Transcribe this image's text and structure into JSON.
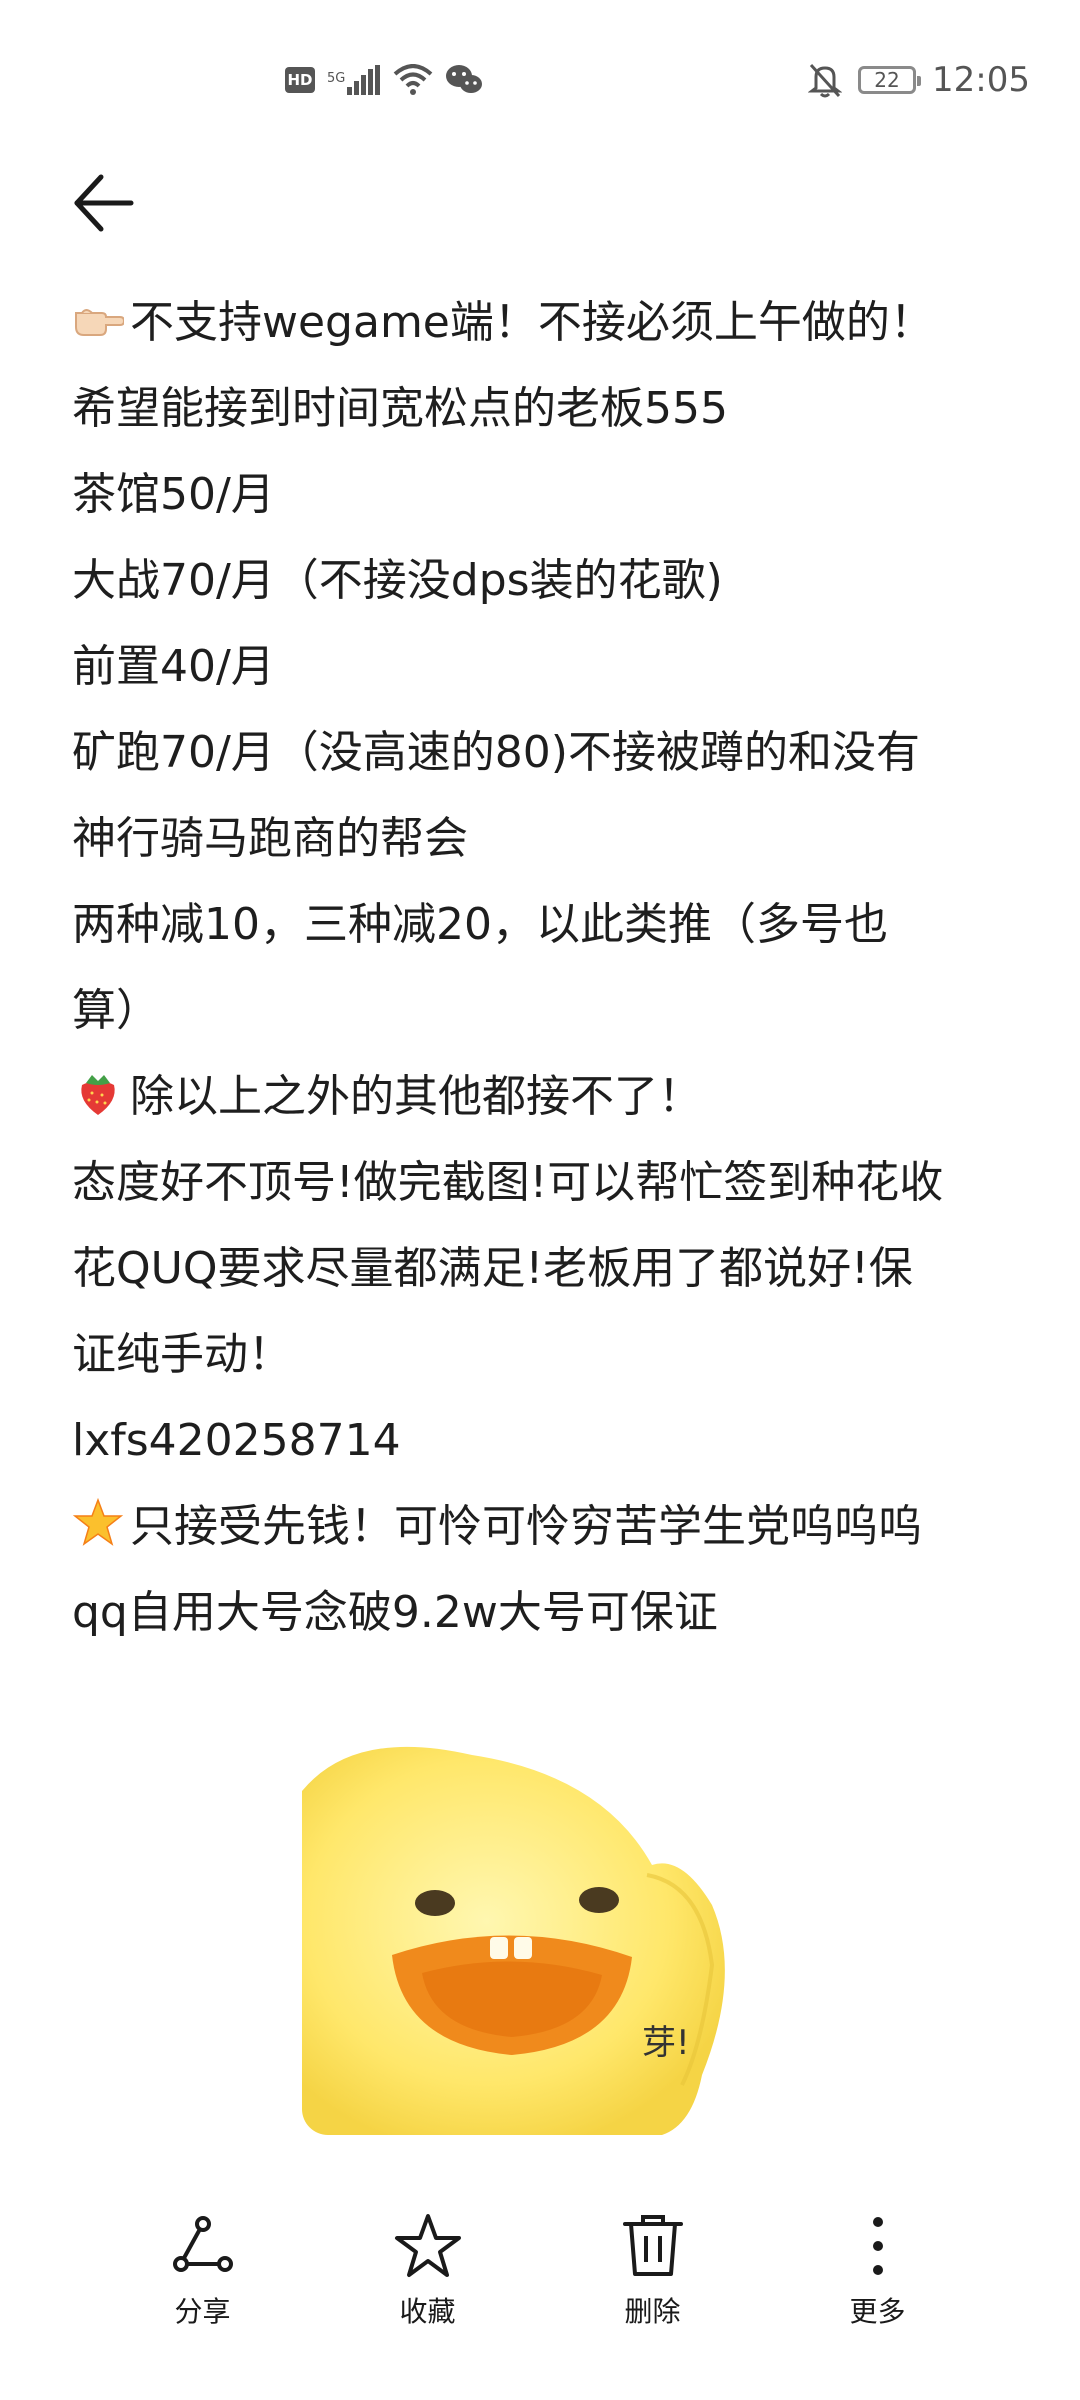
{
  "status_bar": {
    "network_label": "5G",
    "battery": "22",
    "time": "12:05"
  },
  "note": {
    "lines": [
      "不支持wegame端！不接必须上午做的！",
      "希望能接到时间宽松点的老板555",
      "茶馆50/月",
      "大战70/月（不接没dps装的花歌)",
      "前置40/月",
      "矿跑70/月（没高速的80)不接被蹲的和没有",
      "神行骑马跑商的帮会",
      "两种减10，三种减20，以此类推（多号也",
      "算）",
      "除以上之外的其他都接不了！",
      "态度好不顶号!做完截图!可以帮忙签到种花收",
      "花QUQ要求尽量都满足!老板用了都说好!保",
      "证纯手动！",
      "lxfs420258714",
      "只接受先钱！可怜可怜穷苦学生党呜呜呜",
      "qq自用大号念破9.2w大号可保证"
    ]
  },
  "sticker": {
    "text": "芽!"
  },
  "toolbar": {
    "share": "分享",
    "favorite": "收藏",
    "delete": "删除",
    "more": "更多"
  },
  "icons": {
    "line1": "pointing-hand-icon",
    "line10": "strawberry-icon",
    "line15": "star-icon"
  }
}
